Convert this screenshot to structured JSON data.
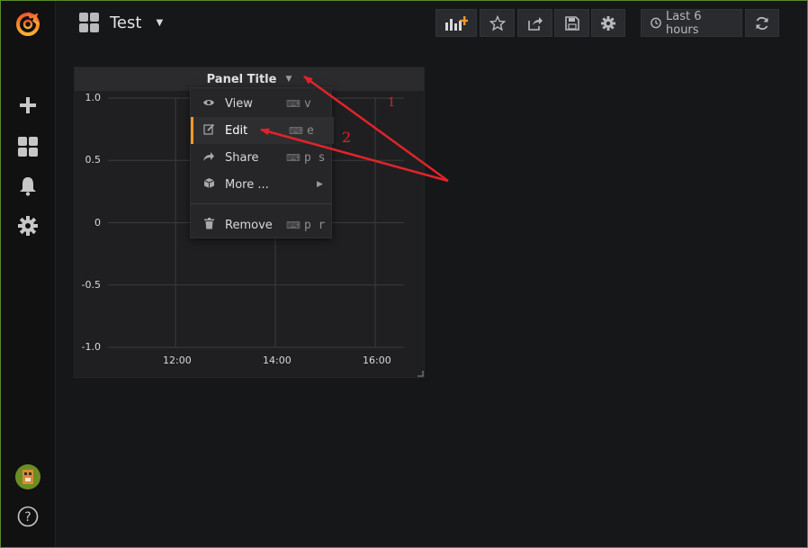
{
  "header": {
    "dashboard_title": "Test",
    "time_range_label": "Last 6 hours"
  },
  "panel": {
    "title": "Panel Title",
    "context_menu": {
      "items": [
        {
          "label": "View",
          "shortcut": "v",
          "icon": "eye-icon"
        },
        {
          "label": "Edit",
          "shortcut": "e",
          "icon": "edit-icon"
        },
        {
          "label": "Share",
          "shortcut": "p s",
          "icon": "share-icon"
        },
        {
          "label": "More ...",
          "shortcut": "",
          "icon": "cube-icon"
        },
        {
          "label": "Remove",
          "shortcut": "p r",
          "icon": "trash-icon"
        }
      ]
    }
  },
  "chart_data": {
    "type": "line",
    "series": [],
    "y_ticks": [
      "1.0",
      "0.5",
      "0",
      "-0.5",
      "-1.0"
    ],
    "x_ticks": [
      "12:00",
      "14:00",
      "16:00"
    ],
    "ylim": [
      -1.0,
      1.0
    ],
    "grid": true
  },
  "annotations": [
    "1",
    "2"
  ],
  "colors": {
    "accent": "#f2992e",
    "annotation": "#e0242a",
    "background": "#161719",
    "panel": "#1f1f21"
  }
}
